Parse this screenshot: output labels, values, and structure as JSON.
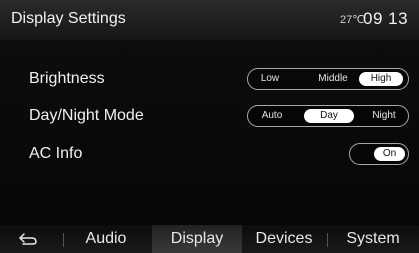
{
  "header": {
    "title": "Display Settings",
    "temperature": "27℃",
    "time": "09 13"
  },
  "settings": {
    "brightness": {
      "label": "Brightness",
      "options": [
        "Low",
        "Middle",
        "High"
      ],
      "selected": "High"
    },
    "day_night_mode": {
      "label": "Day/Night Mode",
      "options": [
        "Auto",
        "Day",
        "Night"
      ],
      "selected": "Day"
    },
    "ac_info": {
      "label": "AC Info",
      "state": "On"
    }
  },
  "nav": {
    "back_icon": "back-arrow-icon",
    "tabs": [
      "Audio",
      "Display",
      "Devices",
      "System"
    ],
    "active": "Display"
  },
  "colors": {
    "selected_bg": "#ffffff",
    "selected_text": "#111111",
    "pill_border": "#a8a8a8"
  }
}
